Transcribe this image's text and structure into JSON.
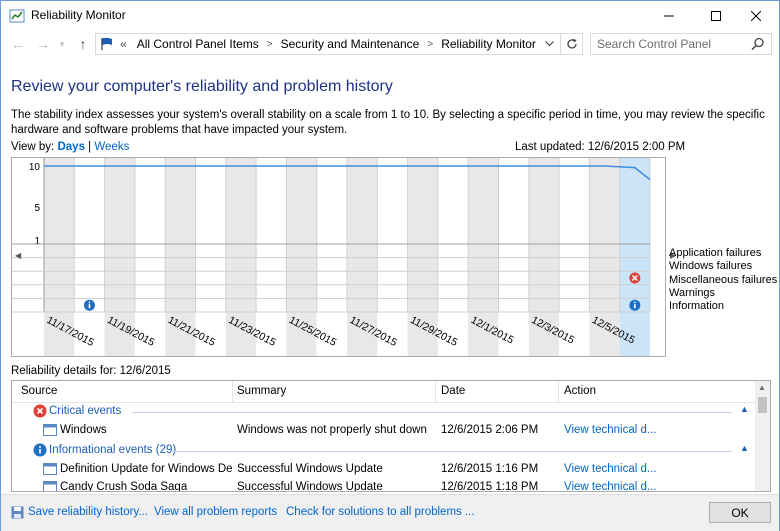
{
  "window": {
    "title": "Reliability Monitor",
    "minimize_glyph": "—",
    "maximize_glyph": "□",
    "close_glyph": "✕"
  },
  "address": {
    "prefix": "«",
    "crumbs": [
      "All Control Panel Items",
      "Security and Maintenance",
      "Reliability Monitor"
    ],
    "search_placeholder": "Search Control Panel"
  },
  "main": {
    "heading": "Review your computer's reliability and problem history",
    "description": "The stability index assesses your system's overall stability on a scale from 1 to 10. By selecting a specific period in time, you may review the specific hardware and software problems that have impacted your system.",
    "view_by_label": "View by:",
    "view_days": "Days",
    "view_sep": "|",
    "view_weeks": "Weeks",
    "last_updated": "Last updated: 12/6/2015 2:00 PM",
    "details_label": "Reliability details for: 12/6/2015"
  },
  "chart_data": {
    "type": "line",
    "y_ticks": [
      "10",
      "5",
      "1"
    ],
    "ylim": [
      1,
      10
    ],
    "columns": 20,
    "date_labels": [
      "11/17/2015",
      "11/19/2015",
      "11/21/2015",
      "11/23/2015",
      "11/25/2015",
      "11/27/2015",
      "11/29/2015",
      "12/1/2015",
      "12/3/2015",
      "12/5/2015"
    ],
    "stability_index": [
      10,
      10,
      10,
      10,
      10,
      10,
      10,
      10,
      10,
      10,
      10,
      10,
      10,
      10,
      10,
      10,
      10,
      10,
      10,
      9.8
    ],
    "selected_column": 19,
    "rows": [
      "Application failures",
      "Windows failures",
      "Miscellaneous failures",
      "Warnings",
      "Information"
    ],
    "events": [
      {
        "column": 1,
        "row": "Information",
        "icon": "info-icon"
      },
      {
        "column": 19,
        "row": "Information",
        "icon": "info-icon"
      },
      {
        "column": 19,
        "row": "Miscellaneous failures",
        "icon": "error-icon"
      }
    ],
    "colors": {
      "line": "#3c8ede",
      "selected": "#cce4f7",
      "weekend": "#e8e8e8",
      "error": "#e0403a",
      "info": "#1f6fc4"
    }
  },
  "table": {
    "headers": {
      "source": "Source",
      "summary": "Summary",
      "date": "Date",
      "action": "Action"
    },
    "groups": [
      {
        "title": "Critical events",
        "icon": "error-icon",
        "rows": [
          {
            "source": "Windows",
            "summary": "Windows was not properly shut down",
            "date": "12/6/2015 2:06 PM",
            "action": "View  technical d..."
          }
        ]
      },
      {
        "title": "Informational events (29)",
        "icon": "info-icon",
        "rows": [
          {
            "source": "Definition Update for Windows Def...",
            "summary": "Successful Windows Update",
            "date": "12/6/2015 1:16 PM",
            "action": "View  technical d..."
          },
          {
            "source": "Candy Crush Soda Saga",
            "summary": "Successful Windows Update",
            "date": "12/6/2015 1:18 PM",
            "action": "View  technical d..."
          }
        ]
      }
    ]
  },
  "footer": {
    "links": [
      "Save reliability history...",
      "View all problem reports",
      "Check for solutions to all problems ..."
    ],
    "ok_label": "OK"
  }
}
